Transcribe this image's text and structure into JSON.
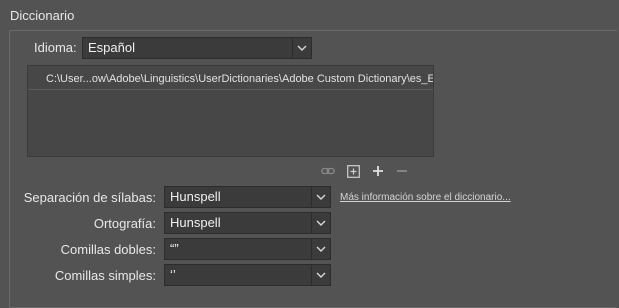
{
  "section": {
    "title": "Diccionario"
  },
  "language": {
    "label": "Idioma:",
    "value": "Español"
  },
  "dictionary_list": {
    "items": [
      "C:\\User...ow\\Adobe\\Linguistics\\UserDictionaries\\Adobe Custom Dictionary\\es_ES"
    ]
  },
  "toolbar": {
    "icons": [
      "link-icon",
      "new-dictionary-icon",
      "add-icon",
      "remove-icon"
    ]
  },
  "hyphenation": {
    "label": "Separación de sílabas:",
    "value": "Hunspell",
    "more_info_link": "Más información sobre el diccionario..."
  },
  "spelling": {
    "label": "Ortografía:",
    "value": "Hunspell"
  },
  "double_quotes": {
    "label": "Comillas dobles:",
    "value": "“”"
  },
  "single_quotes": {
    "label": "Comillas simples:",
    "value": "‘’"
  },
  "colors": {
    "background": "#535353",
    "field_background": "#3b3b3b",
    "list_background": "#474747",
    "text": "#e8e8e8"
  }
}
